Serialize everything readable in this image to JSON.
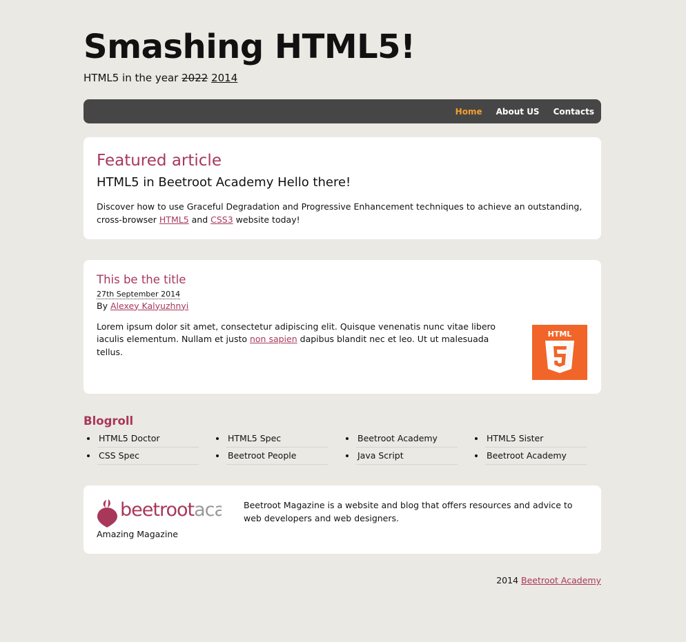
{
  "header": {
    "title": "Smashing HTML5!",
    "tagline_prefix": "HTML5 in the year ",
    "tagline_old_year": "2022",
    "tagline_new_year": "2014"
  },
  "nav": {
    "items": [
      {
        "label": "Home",
        "active": true
      },
      {
        "label": "About US",
        "active": false
      },
      {
        "label": "Contacts",
        "active": false
      }
    ]
  },
  "featured": {
    "heading": "Featured article",
    "subheading": "HTML5 in Beetroot Academy Hello there!",
    "text_before": "Discover how to use Graceful Degradation and Progressive Enhancement techniques to achieve an outstanding, cross-browser ",
    "link1": "HTML5",
    "text_middle": " and ",
    "link2": "CSS3",
    "text_after": " website today!"
  },
  "article": {
    "title": "This be the title",
    "date": "27th September 2014",
    "by_label": "By ",
    "author": "Alexey Kalyuzhnyi",
    "body_before": "Lorem ipsum dolor sit amet, consectetur adipiscing elit. Quisque venenatis nunc vitae libero iaculis elementum. Nullam et justo ",
    "body_link": "non sapien",
    "body_after": " dapibus blandit nec et leo. Ut ut malesuada tellus.",
    "image_label": "HTML",
    "image_number": "5"
  },
  "blogroll": {
    "title": "Blogroll",
    "items": [
      "HTML5 Doctor",
      "HTML5 Spec",
      "Beetroot Academy",
      "HTML5 Sister",
      "CSS Spec",
      "Beetroot People",
      "Java Script",
      "Beetroot Academy"
    ]
  },
  "about": {
    "logo_part1": "beetroot",
    "logo_part2": "academy",
    "caption": "Amazing Magazine",
    "description": "Beetroot Magazine is a website and blog that offers resources and advice to web developers and web designers."
  },
  "footer": {
    "year": "2014 ",
    "link": "Beetroot Academy"
  },
  "colors": {
    "background": "#ebe9e3",
    "accent": "#a8385a",
    "nav_bg": "#464646",
    "nav_active": "#f0a030",
    "html5_orange": "#f16529"
  }
}
